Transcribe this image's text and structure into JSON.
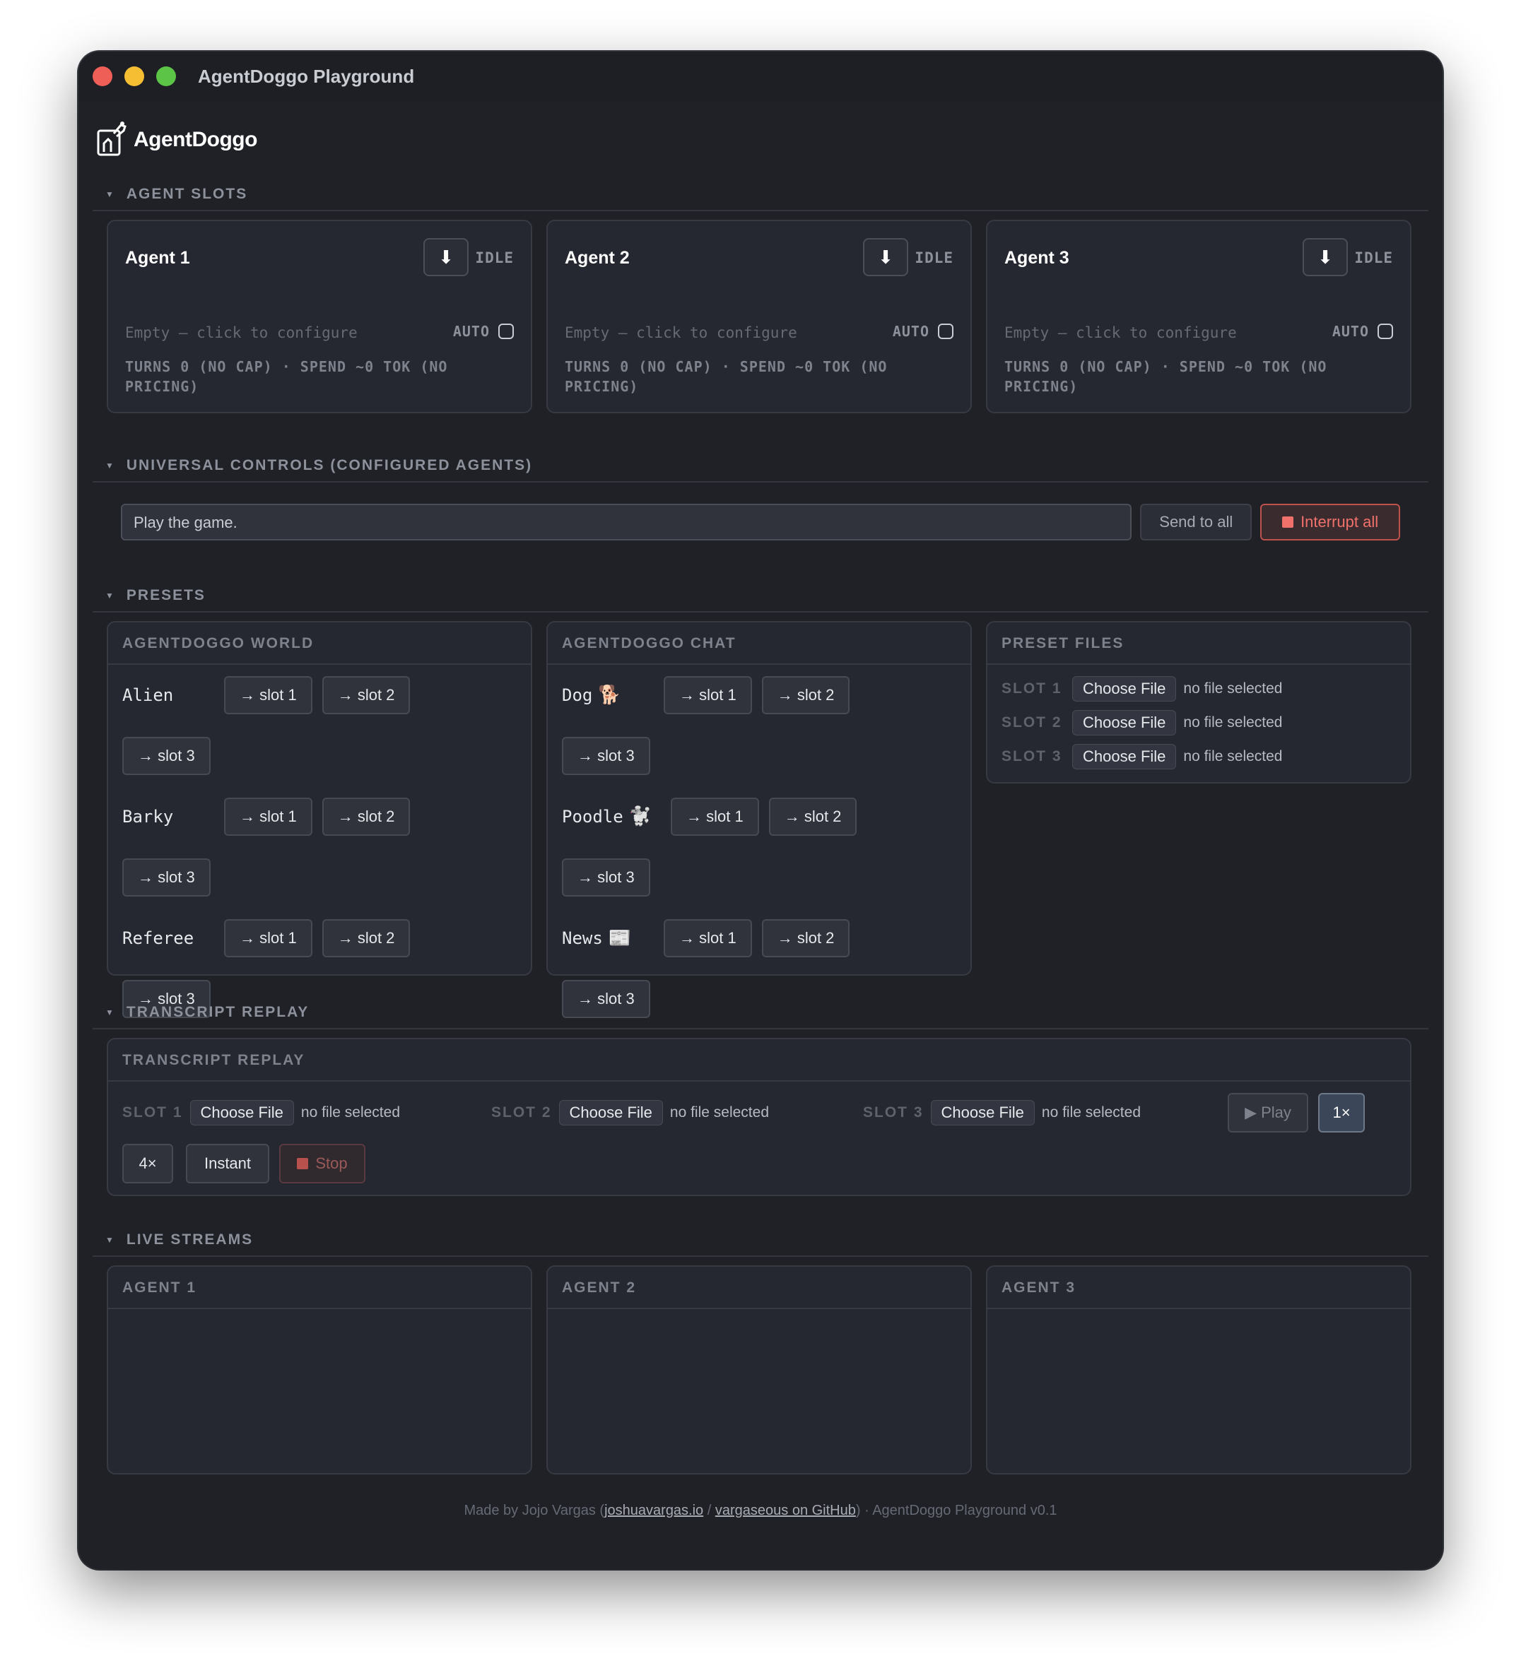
{
  "window": {
    "title": "AgentDoggo Playground"
  },
  "logo": {
    "text": "AgentDoggo"
  },
  "sections": {
    "agent_slots": "AGENT SLOTS",
    "universal_controls": "UNIVERSAL CONTROLS (CONFIGURED AGENTS)",
    "presets": "PRESETS",
    "transcript_replay": "TRANSCRIPT REPLAY",
    "live_streams": "LIVE STREAMS"
  },
  "agents": [
    {
      "name": "Agent 1",
      "status": "IDLE",
      "empty": "Empty — click to configure",
      "auto": "AUTO",
      "stats": "TURNS 0 (NO CAP) · SPEND ~0 TOK (NO PRICING)"
    },
    {
      "name": "Agent 2",
      "status": "IDLE",
      "empty": "Empty — click to configure",
      "auto": "AUTO",
      "stats": "TURNS 0 (NO CAP) · SPEND ~0 TOK (NO PRICING)"
    },
    {
      "name": "Agent 3",
      "status": "IDLE",
      "empty": "Empty — click to configure",
      "auto": "AUTO",
      "stats": "TURNS 0 (NO CAP) · SPEND ~0 TOK (NO PRICING)"
    }
  ],
  "controls": {
    "prompt_value": "Play the game.",
    "send_all": "Send to all",
    "interrupt_all": "Interrupt all"
  },
  "presets": {
    "world": {
      "title": "AGENTDOGGO WORLD",
      "items": [
        {
          "name": "Alien",
          "emoji": ""
        },
        {
          "name": "Barky",
          "emoji": ""
        },
        {
          "name": "Referee",
          "emoji": ""
        }
      ]
    },
    "chat": {
      "title": "AGENTDOGGO CHAT",
      "items": [
        {
          "name": "Dog",
          "emoji": "🐕"
        },
        {
          "name": "Poodle",
          "emoji": "🐩"
        },
        {
          "name": "News",
          "emoji": "📰"
        }
      ]
    },
    "slot_buttons": [
      "→ slot 1",
      "→ slot 2",
      "→ slot 3"
    ],
    "files": {
      "title": "PRESET FILES",
      "rows": [
        {
          "label": "SLOT 1",
          "choose": "Choose File",
          "status": "no file selected"
        },
        {
          "label": "SLOT 2",
          "choose": "Choose File",
          "status": "no file selected"
        },
        {
          "label": "SLOT 3",
          "choose": "Choose File",
          "status": "no file selected"
        }
      ]
    }
  },
  "replay": {
    "title": "TRANSCRIPT REPLAY",
    "slots": [
      {
        "label": "SLOT 1",
        "choose": "Choose File",
        "status": "no file selected"
      },
      {
        "label": "SLOT 2",
        "choose": "Choose File",
        "status": "no file selected"
      },
      {
        "label": "SLOT 3",
        "choose": "Choose File",
        "status": "no file selected"
      }
    ],
    "play": "▶ Play",
    "speed_1x": "1×",
    "speed_4x": "4×",
    "instant": "Instant",
    "stop": "Stop"
  },
  "streams": [
    "AGENT 1",
    "AGENT 2",
    "AGENT 3"
  ],
  "footer": {
    "prefix": "Made by Jojo Vargas (",
    "link1": "joshuavargas.io",
    "sep": " / ",
    "link2": "vargaseous on GitHub",
    "suffix": ") · AgentDoggo Playground v0.1"
  }
}
